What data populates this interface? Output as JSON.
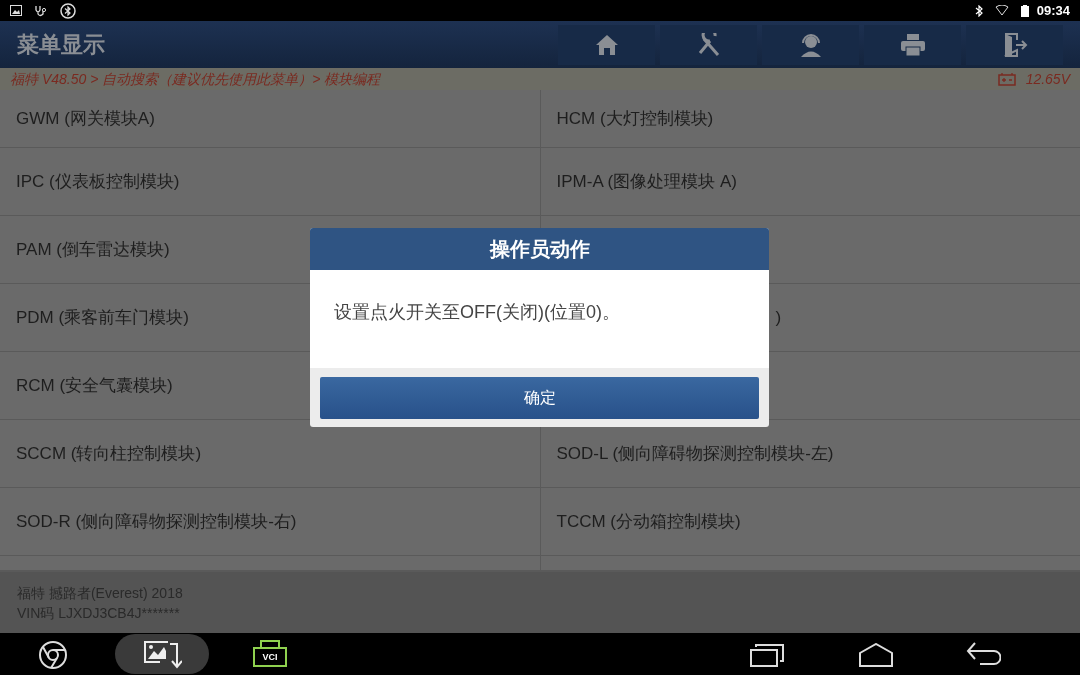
{
  "status_bar": {
    "time": "09:34"
  },
  "header": {
    "title": "菜单显示"
  },
  "breadcrumb": {
    "path": "福特 V48.50 > 自动搜索（建议优先使用此菜单）> 模块编程",
    "voltage": "12.65V"
  },
  "rows": [
    [
      {
        "label": "GWM (网关模块A)"
      },
      {
        "label": "HCM (大灯控制模块)"
      }
    ],
    [
      {
        "label": "IPC (仪表板控制模块)"
      },
      {
        "label": "IPM-A (图像处理模块 A)"
      }
    ],
    [
      {
        "label": "PAM (倒车雷达模块)"
      },
      {
        "kind": "covered"
      }
    ],
    [
      {
        "label": "PDM (乘客前车门模块)"
      },
      {
        "kind": "partial",
        "label": ")"
      }
    ],
    [
      {
        "label": "RCM (安全气囊模块)"
      },
      {
        "kind": "covered"
      }
    ],
    [
      {
        "label": "SCCM (转向柱控制模块)"
      },
      {
        "label": "SOD-L (侧向障碍物探测控制模块-左)"
      }
    ],
    [
      {
        "label": "SOD-R (侧向障碍物探测控制模块-右)"
      },
      {
        "label": "TCCM (分动箱控制模块)"
      }
    ],
    [
      {
        "kind": "cut"
      },
      {
        "kind": "cut"
      }
    ]
  ],
  "footer": {
    "vehicle": "福特 撼路者(Everest) 2018",
    "vin": "VIN码 LJXDJ3CB4J*******"
  },
  "dialog": {
    "title": "操作员动作",
    "message": "设置点火开关至OFF(关闭)(位置0)。",
    "button": "确定"
  },
  "nav_bar": {
    "vci_label": "VCI"
  }
}
